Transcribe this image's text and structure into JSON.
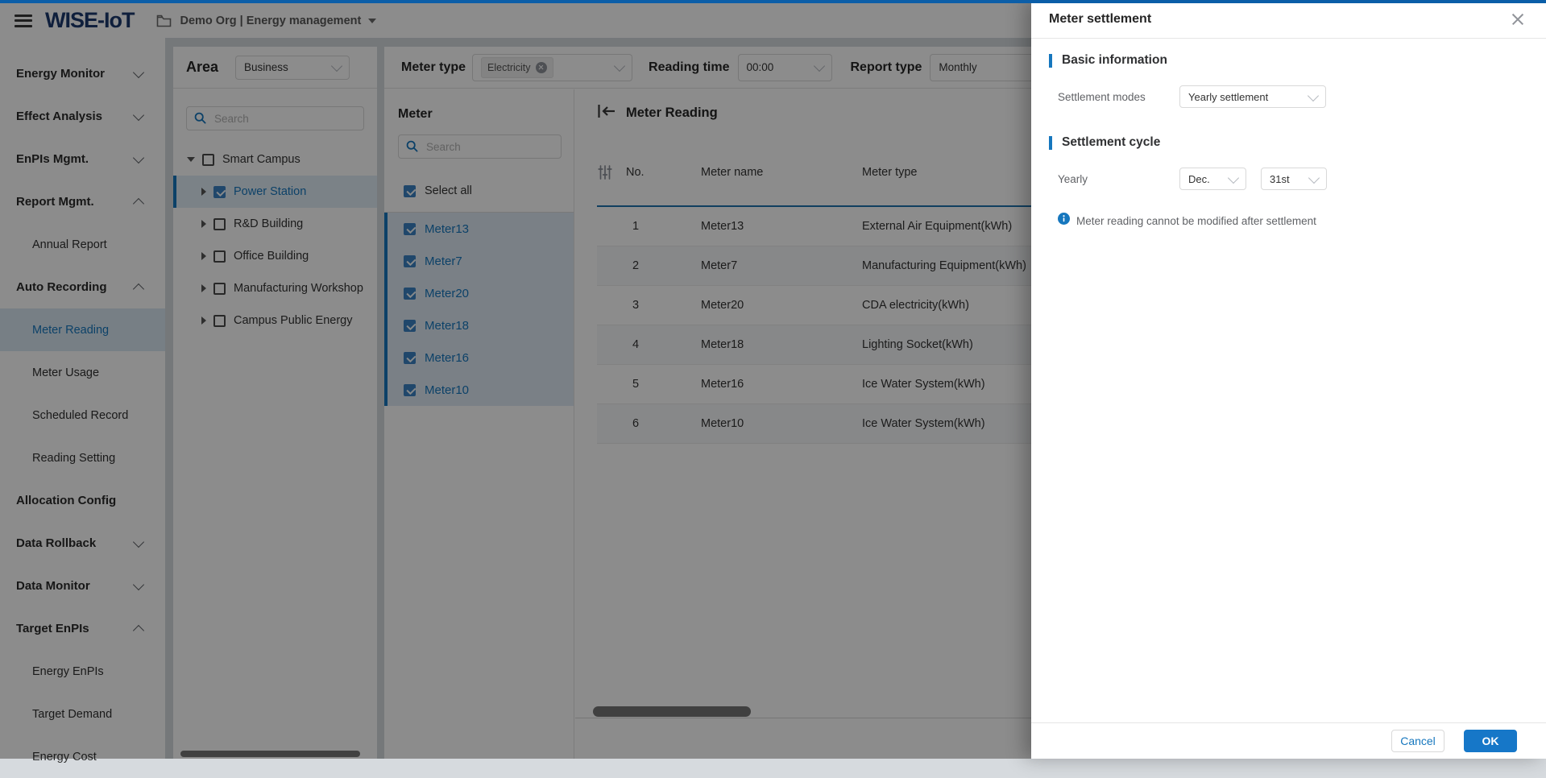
{
  "accent_color": "#1677be",
  "topbar": {
    "logo": "WISE-IoT",
    "org_label": "Demo Org | Energy management"
  },
  "sidebar": {
    "items": [
      {
        "label": "Energy Monitor"
      },
      {
        "label": "Effect Analysis"
      },
      {
        "label": "EnPIs Mgmt."
      },
      {
        "label": "Report Mgmt."
      },
      {
        "label": "Annual Report"
      },
      {
        "label": "Auto Recording"
      },
      {
        "label": "Meter Reading"
      },
      {
        "label": "Meter Usage"
      },
      {
        "label": "Scheduled Record"
      },
      {
        "label": "Reading Setting"
      },
      {
        "label": "Allocation Config"
      },
      {
        "label": "Data Rollback"
      },
      {
        "label": "Data Monitor"
      },
      {
        "label": "Target EnPIs"
      },
      {
        "label": "Energy EnPIs"
      },
      {
        "label": "Target Demand"
      },
      {
        "label": "Energy Cost"
      }
    ]
  },
  "area_panel": {
    "title": "Area",
    "scope_value": "Business",
    "search_placeholder": "Search",
    "tree": [
      {
        "label": "Smart Campus"
      },
      {
        "label": "Power Station"
      },
      {
        "label": "R&D Building"
      },
      {
        "label": "Office Building"
      },
      {
        "label": "Manufacturing Workshop"
      },
      {
        "label": "Campus Public Energy"
      }
    ]
  },
  "filters": {
    "meter_type_label": "Meter type",
    "meter_type_tag": "Electricity",
    "reading_time_label": "Reading time",
    "reading_time_value": "00:00",
    "report_type_label": "Report type",
    "report_type_value": "Monthly"
  },
  "meter_panel": {
    "title": "Meter",
    "search_placeholder": "Search",
    "select_all_label": "Select all",
    "meters": [
      {
        "name": "Meter13"
      },
      {
        "name": "Meter7"
      },
      {
        "name": "Meter20"
      },
      {
        "name": "Meter18"
      },
      {
        "name": "Meter16"
      },
      {
        "name": "Meter10"
      }
    ]
  },
  "reading_panel": {
    "title": "Meter Reading",
    "columns": [
      "No.",
      "Meter name",
      "Meter type"
    ],
    "rows": [
      {
        "no": "1",
        "name": "Meter13",
        "type": "External Air Equipment(kWh)"
      },
      {
        "no": "2",
        "name": "Meter7",
        "type": "Manufacturing Equipment(kWh)"
      },
      {
        "no": "3",
        "name": "Meter20",
        "type": "CDA electricity(kWh)"
      },
      {
        "no": "4",
        "name": "Meter18",
        "type": "Lighting Socket(kWh)"
      },
      {
        "no": "5",
        "name": "Meter16",
        "type": "Ice Water System(kWh)"
      },
      {
        "no": "6",
        "name": "Meter10",
        "type": "Ice Water System(kWh)"
      }
    ]
  },
  "drawer": {
    "title": "Meter settlement",
    "basic_section": "Basic information",
    "settlement_modes_label": "Settlement modes",
    "settlement_modes_value": "Yearly settlement",
    "cycle_section": "Settlement cycle",
    "yearly_label": "Yearly",
    "month_value": "Dec.",
    "day_value": "31st",
    "note": "Meter reading cannot be modified after settlement",
    "cancel_label": "Cancel",
    "ok_label": "OK"
  }
}
